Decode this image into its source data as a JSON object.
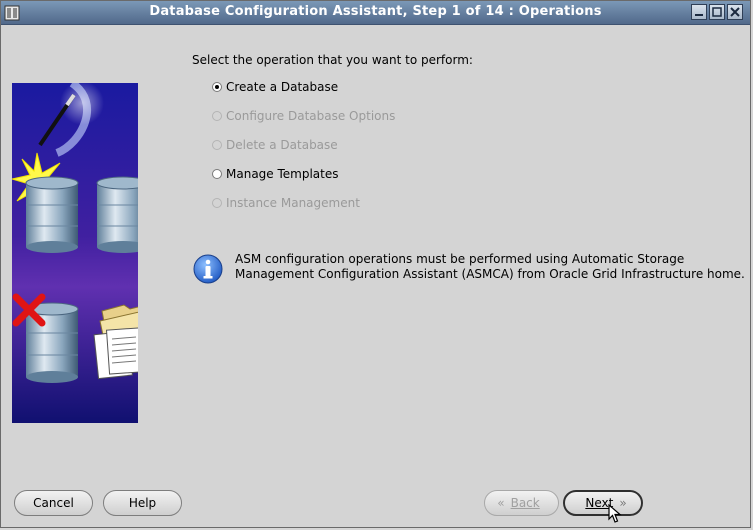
{
  "window": {
    "title": "Database Configuration Assistant, Step 1 of 14 : Operations",
    "app_icon": "database-assistant-icon",
    "controls": [
      "minimize-icon",
      "maximize-icon",
      "close-icon"
    ]
  },
  "main": {
    "prompt": "Select the operation that you want to perform:",
    "options": [
      {
        "label": "Create a Database",
        "selected": true,
        "enabled": true
      },
      {
        "label": "Configure Database Options",
        "selected": false,
        "enabled": false
      },
      {
        "label": "Delete a Database",
        "selected": false,
        "enabled": false
      },
      {
        "label": "Manage Templates",
        "selected": false,
        "enabled": true
      },
      {
        "label": "Instance Management",
        "selected": false,
        "enabled": false
      }
    ],
    "info": {
      "icon": "info-icon",
      "line1": "ASM configuration operations must be performed using Automatic Storage",
      "line2": "Management Configuration Assistant (ASMCA) from Oracle Grid Infrastructure home."
    }
  },
  "footer": {
    "cancel": "Cancel",
    "help": "Help",
    "back": "Back",
    "back_chevron": "«",
    "next": "Next",
    "next_chevron": "»",
    "back_enabled": false
  },
  "colors": {
    "titlebar": "#5f7a9c",
    "window_bg": "#d4d4d4",
    "illustration_bg": "#1c1c8c",
    "info_blue": "#2f6fd3"
  }
}
